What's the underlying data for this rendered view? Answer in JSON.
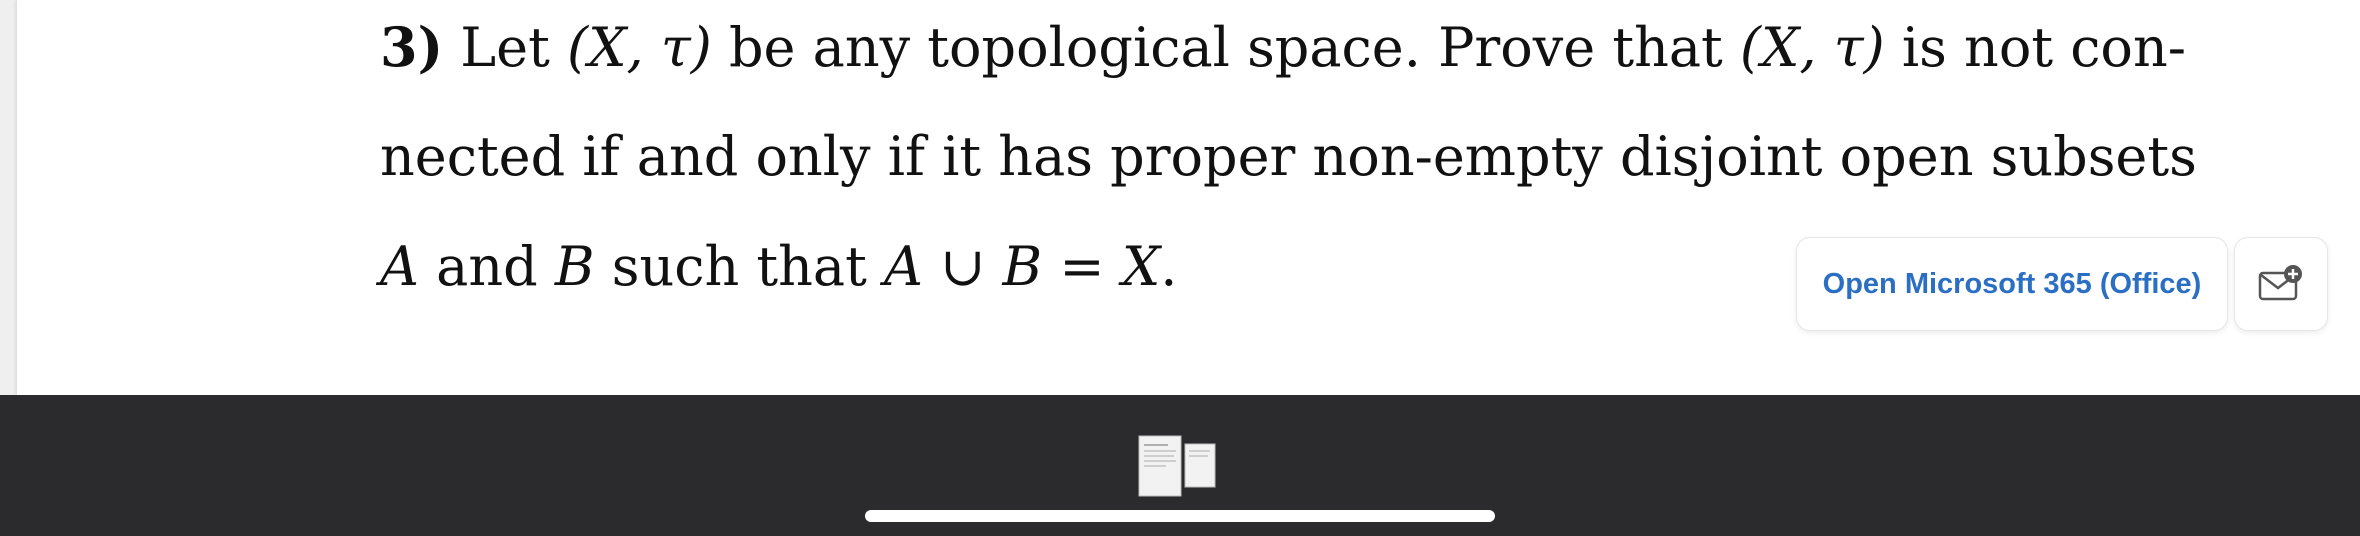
{
  "document": {
    "problem_number": "3)",
    "line1": {
      "let": "Let",
      "space1": "(X, τ)",
      "mid": "be any topological space. Prove that",
      "space2": "(X, τ)",
      "end": "is not con-"
    },
    "line2": {
      "text": "nected if and only if it has proper non-empty disjoint open subsets"
    },
    "line3": {
      "a": "A",
      "and": "and",
      "b": "B",
      "such": "such that",
      "equation": "A ∪ B = X",
      "period": "."
    }
  },
  "actions": {
    "open_office_label": "Open Microsoft 365 (Office)",
    "share_icon": "mail-add-icon"
  },
  "toolbar": {
    "thumbnails_icon": "page-thumbnails-icon"
  },
  "colors": {
    "accent": "#2b6fc4",
    "toolbar_bg": "#2b2b2d",
    "page_bg": "#ffffff"
  }
}
